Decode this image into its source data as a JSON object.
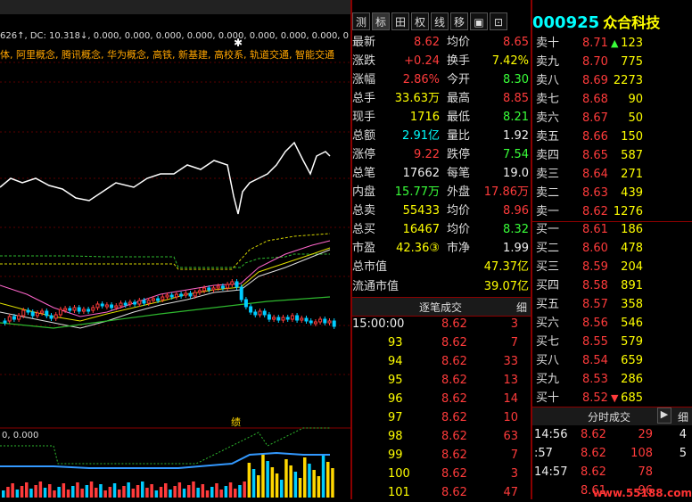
{
  "chart": {
    "indicator_line": "626↑, DC: 10.318↓, 0.000, 0.000, 0.000, 0.000, 0.000, 0.000, 0.000, 0.000, 0",
    "concepts": "体, 阿里概念, 腾讯概念, 华为概念, 高铁, 新基建, 高校系, 轨道交通, 智能交通",
    "ji_label": "绩",
    "volume_label": "0, 0.000"
  },
  "quote": {
    "tabs": [
      "测",
      "标",
      "田",
      "权",
      "线",
      "移",
      "▣",
      "⊡"
    ],
    "rows": [
      {
        "l1": "最新",
        "v1": "8.62",
        "c1": "red",
        "l2": "均价",
        "v2": "8.65",
        "c2": "red"
      },
      {
        "l1": "涨跌",
        "v1": "+0.24",
        "c1": "red",
        "l2": "换手",
        "v2": "7.42%",
        "c2": "yellow"
      },
      {
        "l1": "涨幅",
        "v1": "2.86%",
        "c1": "red",
        "l2": "今开",
        "v2": "8.30",
        "c2": "green"
      },
      {
        "l1": "总手",
        "v1": "33.63万",
        "c1": "yellow",
        "l2": "最高",
        "v2": "8.85",
        "c2": "red"
      },
      {
        "l1": "现手",
        "v1": "1716",
        "c1": "yellow",
        "l2": "最低",
        "v2": "8.21",
        "c2": "green"
      },
      {
        "l1": "总额",
        "v1": "2.91亿",
        "c1": "cyan",
        "l2": "量比",
        "v2": "1.92",
        "c2": "white"
      },
      {
        "l1": "涨停",
        "v1": "9.22",
        "c1": "red",
        "l2": "跌停",
        "v2": "7.54",
        "c2": "green"
      },
      {
        "l1": "总笔",
        "v1": "17662",
        "c1": "white",
        "l2": "每笔",
        "v2": "19.0",
        "c2": "white"
      },
      {
        "l1": "内盘",
        "v1": "15.77万",
        "c1": "green",
        "l2": "外盘",
        "v2": "17.86万",
        "c2": "red"
      },
      {
        "l1": "总卖",
        "v1": "55433",
        "c1": "yellow",
        "l2": "均价",
        "v2": "8.96",
        "c2": "red"
      },
      {
        "l1": "总买",
        "v1": "16467",
        "c1": "yellow",
        "l2": "均价",
        "v2": "8.32",
        "c2": "green"
      },
      {
        "l1": "市盈",
        "v1": "42.36③",
        "c1": "yellow",
        "l2": "市净",
        "v2": "1.99",
        "c2": "white"
      }
    ],
    "total_cap_label": "总市值",
    "total_cap": "47.37亿",
    "float_cap_label": "流通市值",
    "float_cap": "39.07亿",
    "trades_title": "逐笔成交",
    "trades_btn": "细",
    "trades": [
      {
        "t": "15:00:00",
        "p": "8.62",
        "v": "3"
      },
      {
        "t": "93",
        "p": "8.62",
        "v": "7"
      },
      {
        "t": "94",
        "p": "8.62",
        "v": "33"
      },
      {
        "t": "95",
        "p": "8.62",
        "v": "13"
      },
      {
        "t": "96",
        "p": "8.62",
        "v": "14"
      },
      {
        "t": "97",
        "p": "8.62",
        "v": "10"
      },
      {
        "t": "98",
        "p": "8.62",
        "v": "63"
      },
      {
        "t": "99",
        "p": "8.62",
        "v": "7"
      },
      {
        "t": "100",
        "p": "8.62",
        "v": "3"
      },
      {
        "t": "101",
        "p": "8.62",
        "v": "47"
      }
    ]
  },
  "book": {
    "code": "000925",
    "name": "众合科技",
    "sells": [
      {
        "l": "卖十",
        "p": "8.71",
        "v": "123",
        "arrow": "up"
      },
      {
        "l": "卖九",
        "p": "8.70",
        "v": "775"
      },
      {
        "l": "卖八",
        "p": "8.69",
        "v": "2273"
      },
      {
        "l": "卖七",
        "p": "8.68",
        "v": "90"
      },
      {
        "l": "卖六",
        "p": "8.67",
        "v": "50"
      },
      {
        "l": "卖五",
        "p": "8.66",
        "v": "150"
      },
      {
        "l": "卖四",
        "p": "8.65",
        "v": "587"
      },
      {
        "l": "卖三",
        "p": "8.64",
        "v": "271"
      },
      {
        "l": "卖二",
        "p": "8.63",
        "v": "439"
      },
      {
        "l": "卖一",
        "p": "8.62",
        "v": "1276"
      }
    ],
    "buys": [
      {
        "l": "买一",
        "p": "8.61",
        "v": "186"
      },
      {
        "l": "买二",
        "p": "8.60",
        "v": "478"
      },
      {
        "l": "买三",
        "p": "8.59",
        "v": "204"
      },
      {
        "l": "买四",
        "p": "8.58",
        "v": "891"
      },
      {
        "l": "买五",
        "p": "8.57",
        "v": "358"
      },
      {
        "l": "买六",
        "p": "8.56",
        "v": "546"
      },
      {
        "l": "买七",
        "p": "8.55",
        "v": "579"
      },
      {
        "l": "买八",
        "p": "8.54",
        "v": "659"
      },
      {
        "l": "买九",
        "p": "8.53",
        "v": "286"
      },
      {
        "l": "买十",
        "p": "8.52",
        "v": "685",
        "arrow": "down"
      }
    ],
    "ts_title": "分时成交",
    "ts_btn": "细",
    "ts_rows": [
      {
        "t": "14:56",
        "p": "8.62",
        "v": "29",
        "n": "4"
      },
      {
        "t": ":57",
        "p": "8.62",
        "v": "108",
        "n": "5"
      },
      {
        "t": "14:57",
        "p": "8.62",
        "v": "78",
        "n": ""
      },
      {
        "t": "",
        "p": "8.61",
        "v": "96",
        "n": ""
      }
    ],
    "watermark": "www.55188.com"
  }
}
